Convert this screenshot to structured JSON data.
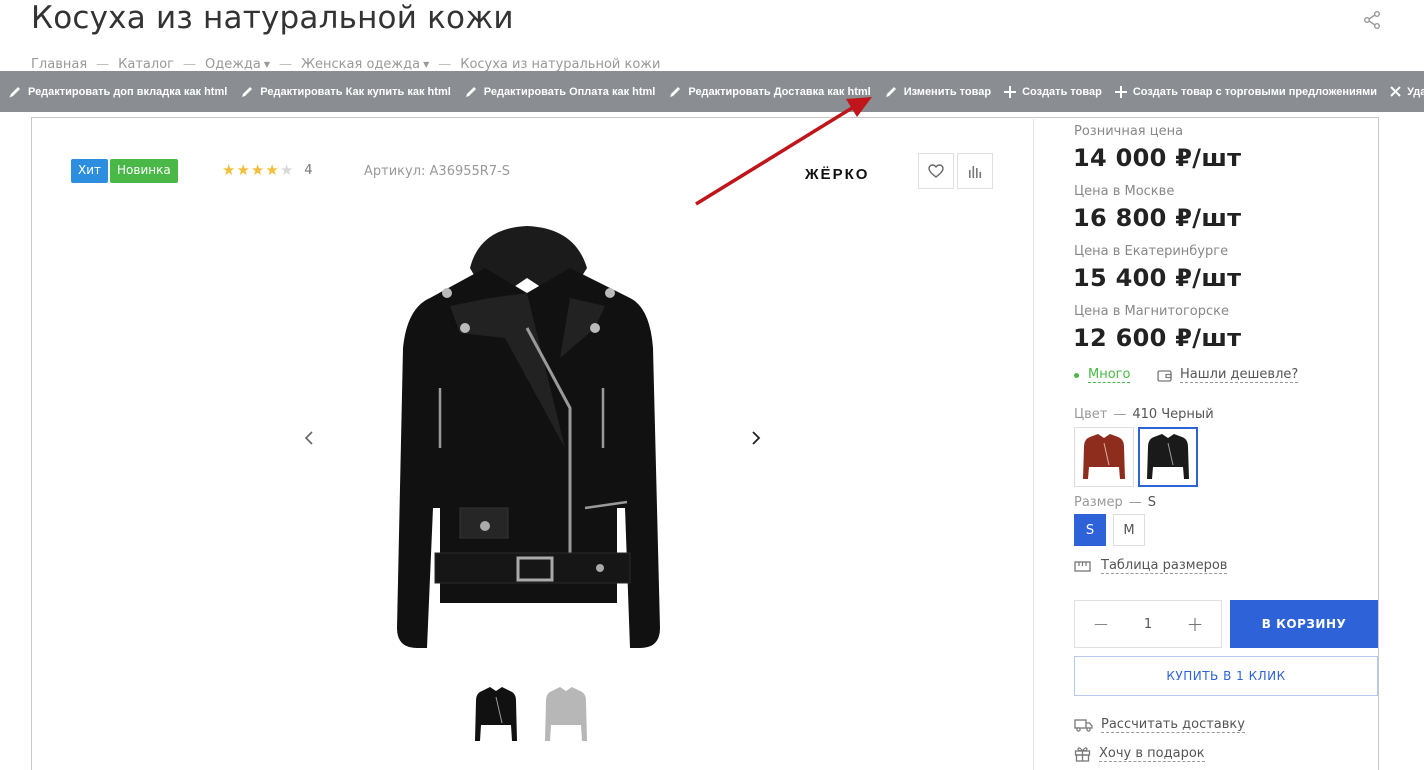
{
  "page": {
    "title": "Косуха из натуральной кожи"
  },
  "breadcrumb": {
    "items": [
      "Главная",
      "Каталог",
      "Одежда",
      "Женская одежда",
      "Косуха из натуральной кожи"
    ]
  },
  "admin_bar": {
    "items": [
      {
        "label": "Редактировать доп вкладка как html",
        "icon": "pencil-icon"
      },
      {
        "label": "Редактировать Как купить как html",
        "icon": "pencil-icon"
      },
      {
        "label": "Редактировать Оплата как html",
        "icon": "pencil-icon"
      },
      {
        "label": "Редактировать Доставка как html",
        "icon": "pencil-icon"
      },
      {
        "label": "Изменить товар",
        "icon": "pencil-icon"
      },
      {
        "label": "Создать товар",
        "icon": "plus-icon"
      },
      {
        "label": "Создать товар с торговыми предложениями",
        "icon": "plus-icon"
      },
      {
        "label": "Удалить товар",
        "icon": "close-icon"
      }
    ]
  },
  "product": {
    "badges": [
      "Хит",
      "Новинка"
    ],
    "rating": {
      "stars": 4,
      "max": 5,
      "count": "4"
    },
    "sku": "Артикул: A36955R7-S",
    "brand": "ЖЁРКО"
  },
  "prices": [
    {
      "label": "Розничная цена",
      "value": "14 000 ₽/шт"
    },
    {
      "label": "Цена в Москве",
      "value": "16 800 ₽/шт"
    },
    {
      "label": "Цена в Екатеринбурге",
      "value": "15 400 ₽/шт"
    },
    {
      "label": "Цена в Магнитогорске",
      "value": "12 600 ₽/шт"
    }
  ],
  "stock": {
    "label": "Много",
    "cheaper_label": "Нашли дешевле?"
  },
  "color": {
    "label": "Цвет",
    "value": "410 Черный",
    "swatches": [
      "#8e2d1e",
      "#1a1a1a"
    ]
  },
  "size": {
    "label": "Размер",
    "value": "S",
    "options": [
      "S",
      "M"
    ],
    "table_label": "Таблица размеров"
  },
  "quantity": {
    "value": "1"
  },
  "buttons": {
    "cart": "В КОРЗИНУ",
    "one_click": "КУПИТЬ В 1 КЛИК"
  },
  "extras": {
    "delivery": "Рассчитать доставку",
    "gift": "Хочу в подарок"
  },
  "colors": {
    "accent": "#2e62d9",
    "green": "#4ab847",
    "admin_bar": "#8a8d92",
    "hit_badge": "#2d8ee0",
    "arrow": "#c0151a"
  }
}
